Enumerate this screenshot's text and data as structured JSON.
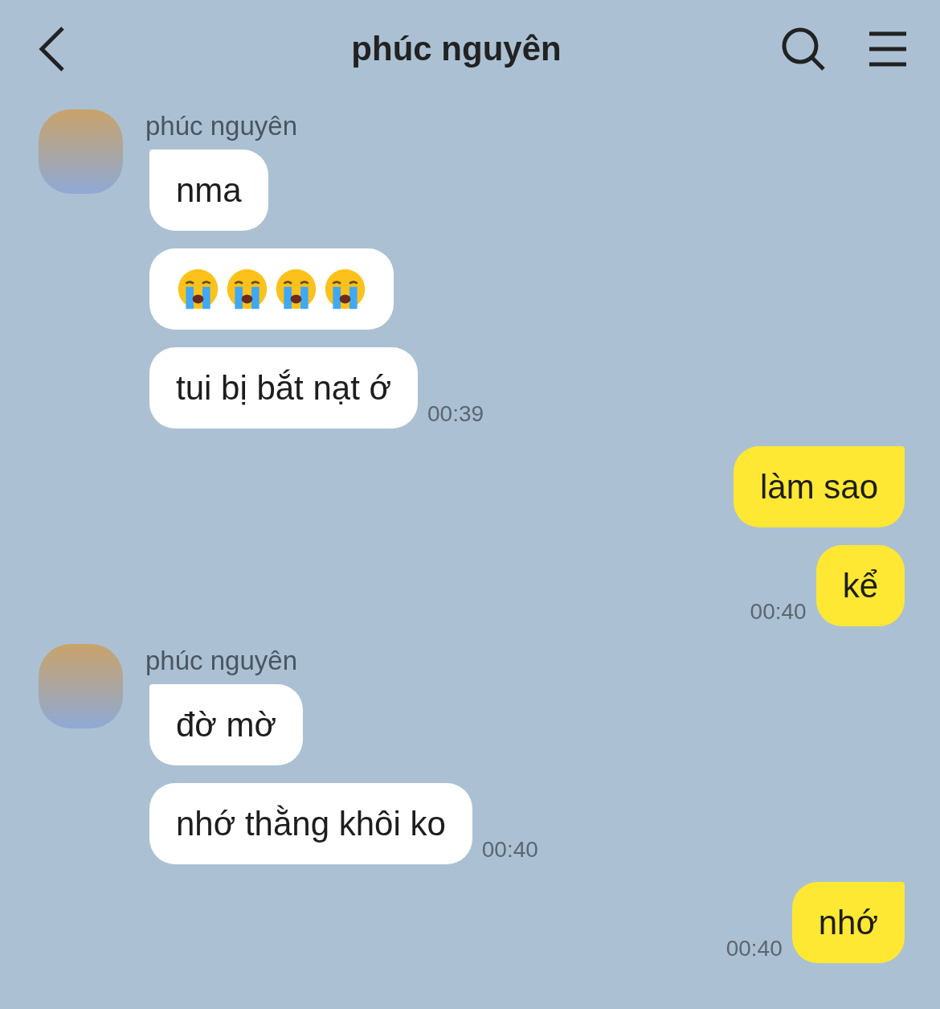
{
  "header": {
    "title": "phúc nguyên"
  },
  "messages": [
    {
      "kind": "incoming",
      "sender": "phúc nguyên",
      "bubbles": [
        {
          "kind": "text",
          "text": "nma"
        },
        {
          "kind": "emoji",
          "emojis": [
            {
              "kind": "crying"
            },
            {
              "kind": "crying"
            },
            {
              "kind": "crying"
            },
            {
              "kind": "crying"
            }
          ]
        },
        {
          "kind": "text",
          "text": "tui bị bắt nạt ớ"
        }
      ],
      "time": "00:39"
    },
    {
      "kind": "outgoing",
      "bubbles": [
        {
          "kind": "text",
          "text": "làm sao"
        },
        {
          "kind": "text",
          "text": "kể"
        }
      ],
      "time": "00:40"
    },
    {
      "kind": "incoming",
      "sender": "phúc nguyên",
      "bubbles": [
        {
          "kind": "text",
          "text": "đờ mờ"
        },
        {
          "kind": "text",
          "text": "nhớ thằng khôi ko"
        }
      ],
      "time": "00:40"
    },
    {
      "kind": "outgoing",
      "bubbles": [
        {
          "kind": "text",
          "text": "nhớ"
        }
      ],
      "time": "00:40"
    }
  ]
}
